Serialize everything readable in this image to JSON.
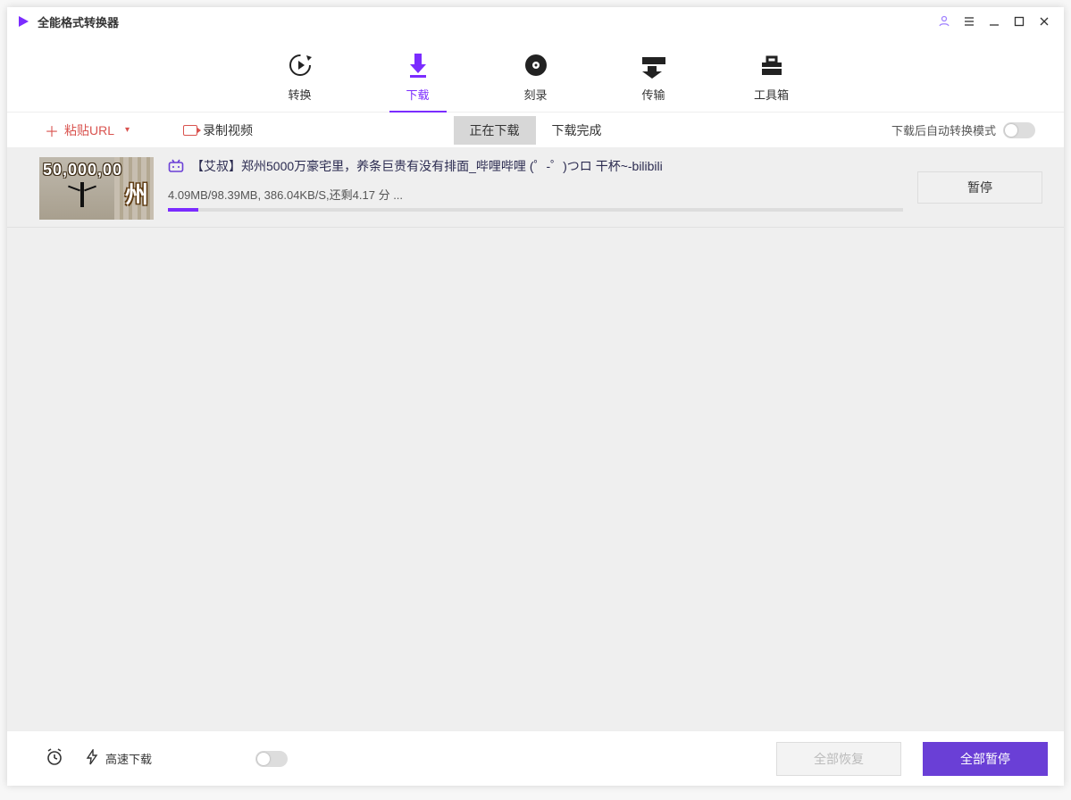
{
  "app": {
    "title": "全能格式转换器"
  },
  "tabs": {
    "convert": "转换",
    "download": "下载",
    "burn": "刻录",
    "transfer": "传输",
    "toolbox": "工具箱"
  },
  "subbar": {
    "paste_label": "粘贴URL",
    "record_label": "录制视频",
    "tab_downloading": "正在下载",
    "tab_finished": "下载完成",
    "auto_convert_label": "下载后自动转换模式"
  },
  "item": {
    "title": "【艾叔】郑州5000万豪宅里，养条巨贵有没有排面_哔哩哔哩 (゜-゜)つロ 干杯~-bilibili",
    "stats": "4.09MB/98.39MB, 386.04KB/S,还剩4.17 分 ...",
    "progress_percent": 4.16,
    "pause_label": "暂停",
    "thumb_price": "50,000,00",
    "thumb_cn": "州"
  },
  "footer": {
    "high_speed_label": "高速下载",
    "resume_all": "全部恢复",
    "pause_all": "全部暂停"
  },
  "colors": {
    "accent": "#7b2cff",
    "danger": "#d9534f"
  }
}
